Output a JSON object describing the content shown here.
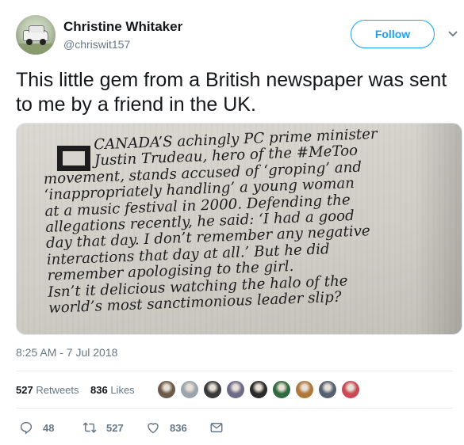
{
  "author": {
    "name": "Christine Whitaker",
    "handle": "@chriswit157",
    "avatar_icon": "profile-photo-car"
  },
  "follow_label": "Follow",
  "tweet": {
    "text": "This little gem from a British newspaper was sent to me by a friend in the UK.",
    "image": {
      "lines": [
        "CANADA’S achingly PC prime minister",
        "Justin Trudeau, hero of the #MeToo",
        "movement, stands accused of ‘groping’ and",
        "‘inappropriately handling’ a young woman",
        "at a music festival in 2000. Defending the",
        "allegations recently, he said: ‘I had a good",
        "day that day. I don’t remember any negative",
        "interactions that day at all.’ But he did",
        "remember apologising to the girl.",
        "Isn’t it delicious watching the halo of the",
        "world’s most sanctimonious leader slip?"
      ]
    }
  },
  "timestamp": "8:25 AM - 7 Jul 2018",
  "stats": {
    "retweets_count": "527",
    "retweets_label": "Retweets",
    "likes_count": "836",
    "likes_label": "Likes"
  },
  "likers": [
    {
      "color": "#6b5a4a"
    },
    {
      "color": "#9aa5ad"
    },
    {
      "color": "#3a3a3a"
    },
    {
      "color": "#6d6a8a"
    },
    {
      "color": "#2b2b2b"
    },
    {
      "color": "#2f6b3f"
    },
    {
      "color": "#b0773c"
    },
    {
      "color": "#556070"
    },
    {
      "color": "#c94a55"
    }
  ],
  "actions": {
    "reply_count": "48",
    "retweet_count": "527",
    "like_count": "836"
  },
  "colors": {
    "accent": "#1da1f2",
    "muted": "#657786",
    "text": "#14171a"
  }
}
